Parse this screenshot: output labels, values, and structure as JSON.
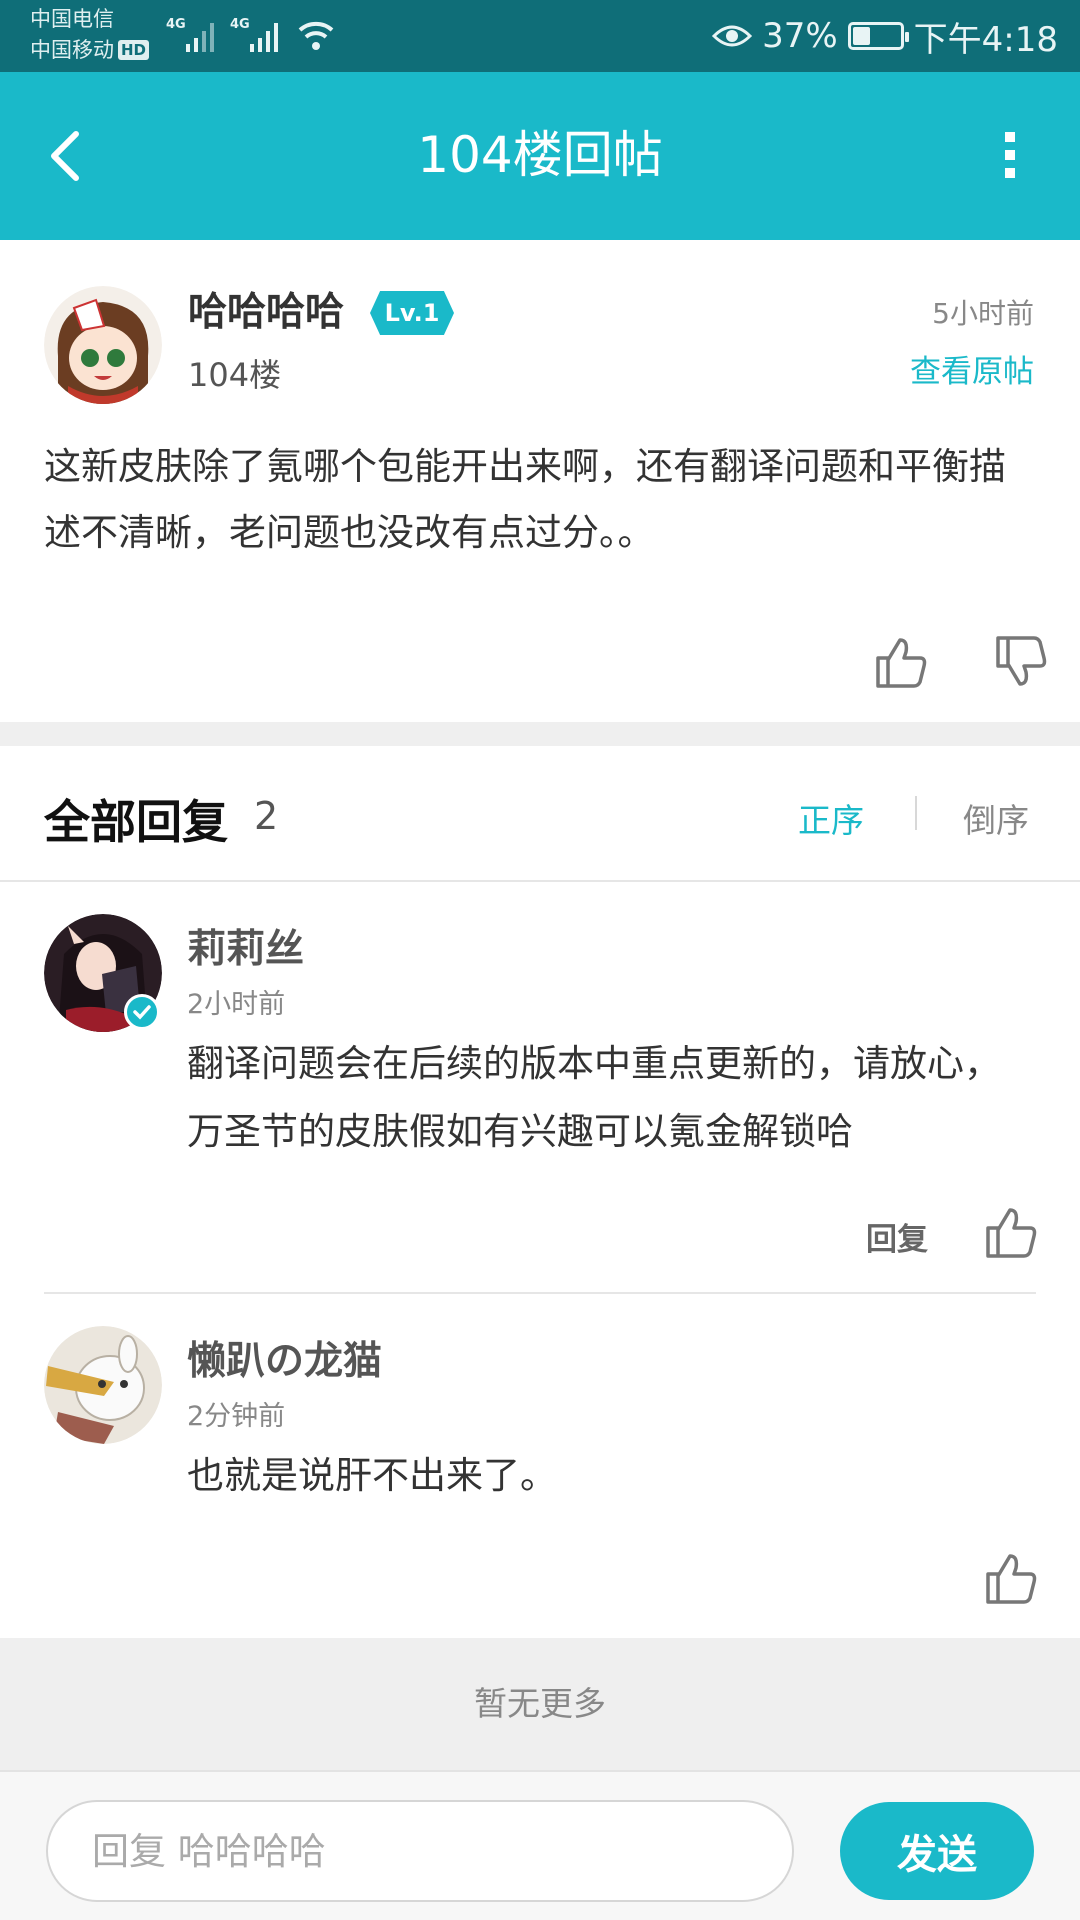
{
  "status_bar": {
    "carrier_1": "中国电信",
    "carrier_2": "中国移动",
    "hd_badge": "HD",
    "network_1": "4G",
    "network_2": "4G",
    "battery_percent": "37%",
    "battery_level": 0.37,
    "time": "下午4:18"
  },
  "header": {
    "title": "104楼回帖",
    "back_icon": "chevron-left-icon",
    "more_icon": "more-vertical-icon"
  },
  "post": {
    "username": "哈哈哈哈",
    "level": "Lv.1",
    "floor": "104楼",
    "time": "5小时前",
    "view_original": "查看原帖",
    "body": "这新皮肤除了氪哪个包能开出来啊，还有翻译问题和平衡描述不清晰，老问题也没改有点过分。。"
  },
  "replies_header": {
    "title": "全部回复",
    "count": "2",
    "sort_asc": "正序",
    "sort_desc": "倒序"
  },
  "replies": [
    {
      "username": "莉莉丝",
      "time": "2小时前",
      "body": "翻译问题会在后续的版本中重点更新的，请放心，万圣节的皮肤假如有兴趣可以氪金解锁哈",
      "reply_label": "回复",
      "verified": true
    },
    {
      "username": "懒趴の龙猫",
      "time": "2分钟前",
      "body": "也就是说肝不出来了。"
    }
  ],
  "footer": {
    "no_more": "暂无更多"
  },
  "bottom_bar": {
    "input_placeholder": "回复 哈哈哈哈",
    "send_label": "发送"
  },
  "colors": {
    "accent": "#1ab9c9",
    "status_bar": "#0f6e78"
  }
}
